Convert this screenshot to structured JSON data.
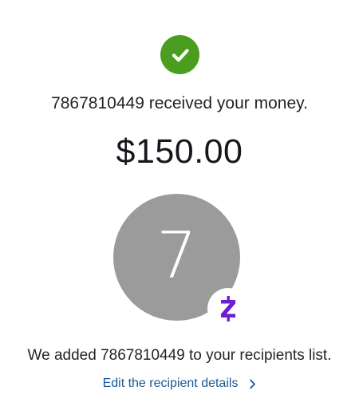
{
  "confirmation": {
    "received_message": "7867810449 received your money.",
    "amount": "$150.00"
  },
  "recipient": {
    "avatar_initial": "7",
    "badge_icon": "zelle-logo-icon"
  },
  "footer": {
    "added_message": "We added 7867810449 to your recipients list.",
    "edit_link_label": "Edit the recipient details"
  },
  "icons": {
    "success": "checkmark-circle-icon",
    "link_arrow": "chevron-right-icon"
  },
  "colors": {
    "success_green": "#4a9d1f",
    "avatar_gray": "#9b9b9b",
    "zelle_purple": "#6d1ed4",
    "link_blue": "#1a5a96"
  }
}
